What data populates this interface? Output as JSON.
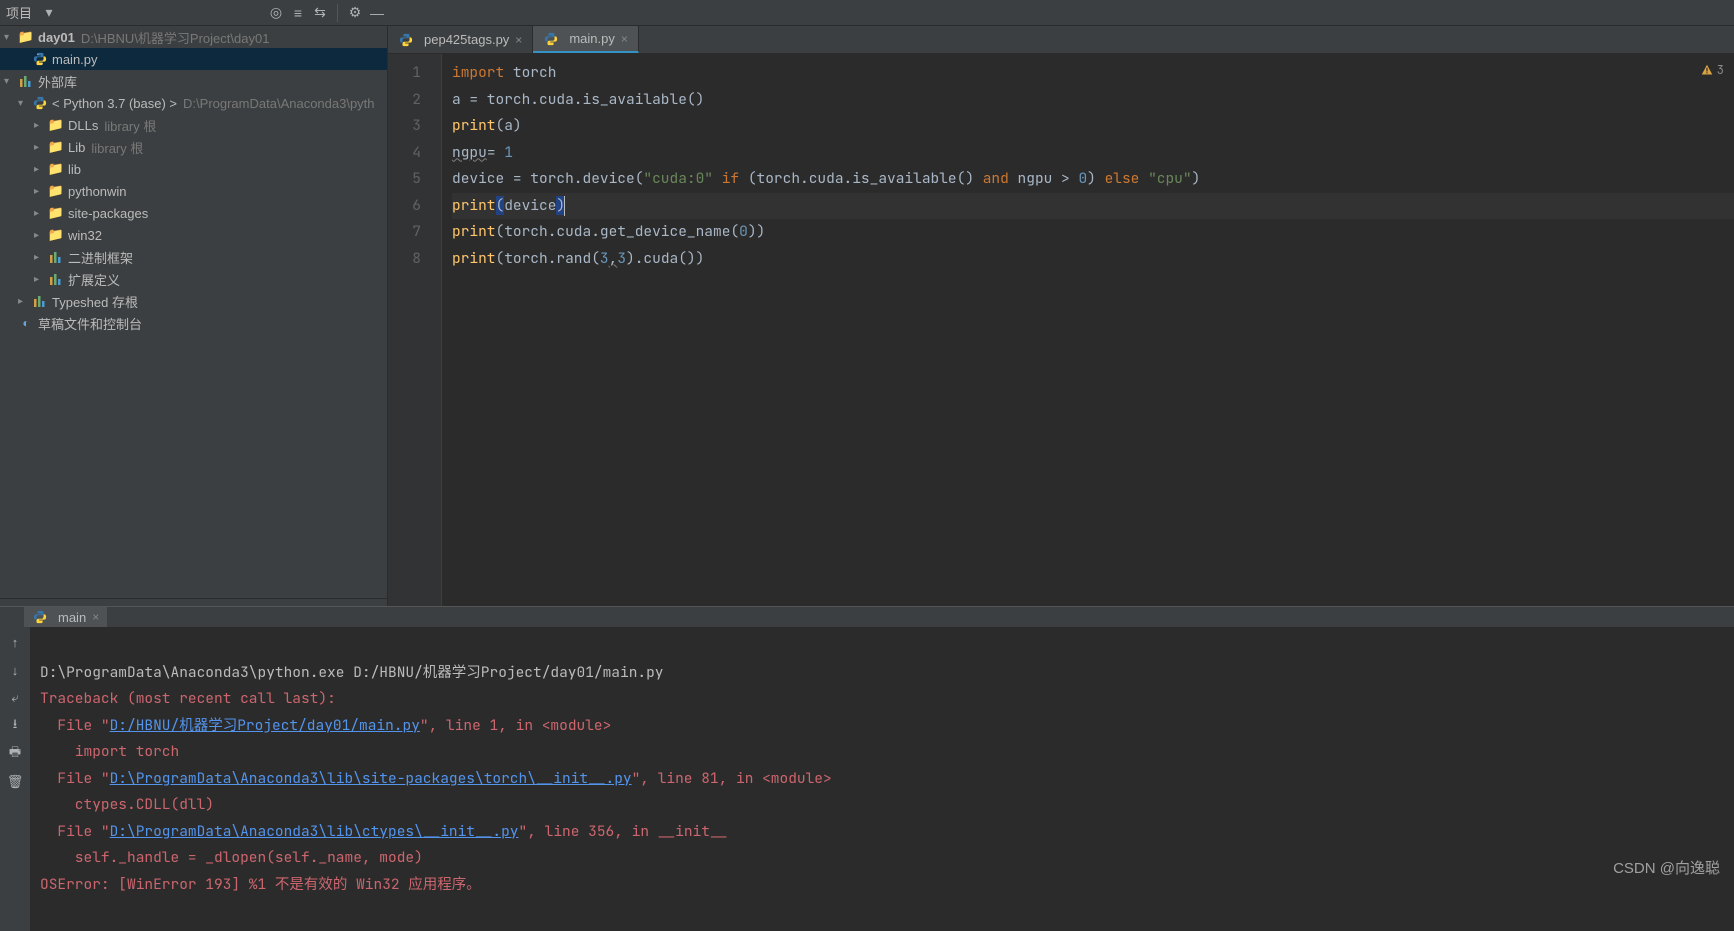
{
  "toolbar": {
    "project_label": "项目"
  },
  "tabs": [
    {
      "name": "pep425tags.py",
      "active": false
    },
    {
      "name": "main.py",
      "active": true
    }
  ],
  "project_tree": {
    "root": {
      "name": "day01",
      "path": "D:\\HBNU\\机器学习Project\\day01"
    },
    "root_file": "main.py",
    "external_label": "外部库",
    "python_env": "< Python 3.7 (base) >",
    "python_env_path": "D:\\ProgramData\\Anaconda3\\pyth",
    "dlls": {
      "name": "DLLs",
      "hint": "library 根"
    },
    "lib_up": {
      "name": "Lib",
      "hint": "library 根"
    },
    "lib": "lib",
    "pythonwin": "pythonwin",
    "site_packages": "site-packages",
    "win32": "win32",
    "binary": "二进制框架",
    "ext_defs": "扩展定义",
    "typeshed": "Typeshed 存根",
    "scratch": "草稿文件和控制台"
  },
  "indicator": {
    "count": "3"
  },
  "code": {
    "lines": [
      "1",
      "2",
      "3",
      "4",
      "5",
      "6",
      "7",
      "8"
    ],
    "l1a": "import",
    "l1b": " torch",
    "l2": "a = torch.cuda.is_available()",
    "l3a": "print",
    "l3b": "(a)",
    "l4a": "ngpu",
    "l4b": "= ",
    "l4c": "1",
    "l5a": "device = torch.device(",
    "l5b": "\"cuda:0\"",
    "l5c": " if ",
    "l5d": "(torch.cuda.is_available() ",
    "l5e": "and",
    "l5f": " ngpu > ",
    "l5g": "0",
    "l5h": ") ",
    "l5i": "else ",
    "l5j": "\"cpu\"",
    "l5k": ")",
    "l6a": "print",
    "l6b": "(",
    "l6c": "device",
    "l6d": ")",
    "l7a": "print",
    "l7b": "(torch.cuda.get_device_name(",
    "l7c": "0",
    "l7d": "))",
    "l8a": "print",
    "l8b": "(torch.rand(",
    "l8c": "3",
    "l8d": ",",
    "l8e": "3",
    "l8f": ").cuda())"
  },
  "console": {
    "tab": "main",
    "cmd": "D:\\ProgramData\\Anaconda3\\python.exe D:/HBNU/机器学习Project/day01/main.py",
    "tb": "Traceback (most recent call last):",
    "f1a": "  File \"",
    "f1link": "D:/HBNU/机器学习Project/day01/main.py",
    "f1b": "\", line 1, in <module>",
    "f1code": "    import torch",
    "f2a": "  File \"",
    "f2link": "D:\\ProgramData\\Anaconda3\\lib\\site-packages\\torch\\__init__.py",
    "f2b": "\", line 81, in <module>",
    "f2code": "    ctypes.CDLL(dll)",
    "f3a": "  File \"",
    "f3link": "D:\\ProgramData\\Anaconda3\\lib\\ctypes\\__init__.py",
    "f3b": "\", line 356, in __init__",
    "f3code": "    self._handle = _dlopen(self._name, mode)",
    "oserr": "OSError: [WinError 193] %1 不是有效的 Win32 应用程序。"
  },
  "watermark": "CSDN @向逸聪"
}
